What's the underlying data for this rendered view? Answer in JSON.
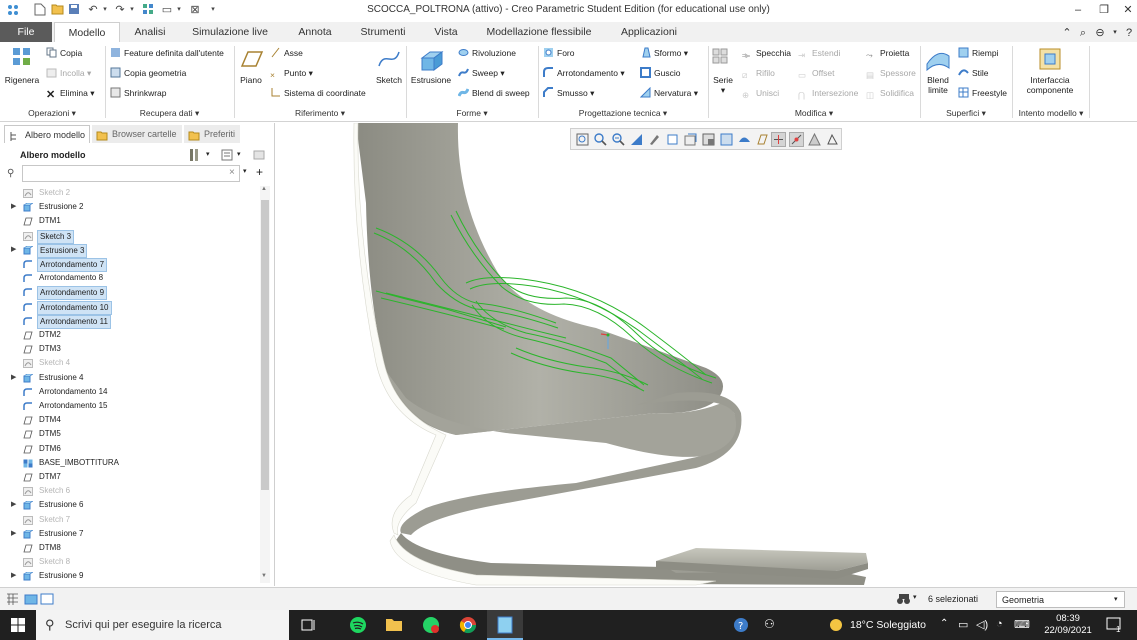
{
  "window": {
    "title": "SCOCCA_POLTRONA (attivo) - Creo Parametric Student Edition (for educational use only)"
  },
  "tabs": [
    "File",
    "Modello",
    "Analisi",
    "Simulazione live",
    "Annota",
    "Strumenti",
    "Vista",
    "Modellazione flessibile",
    "Applicazioni"
  ],
  "ribbon": {
    "operazioni": {
      "rigenera": "Rigenera",
      "copia": "Copia",
      "incolla": "Incolla",
      "elimina": "Elimina",
      "group": "Operazioni"
    },
    "recupera": {
      "feature": "Feature definita dall'utente",
      "copia_geom": "Copia geometria",
      "shrinkwrap": "Shrinkwrap",
      "group": "Recupera dati"
    },
    "riferimento": {
      "piano": "Piano",
      "asse": "Asse",
      "punto": "Punto",
      "sistema": "Sistema di coordinate",
      "sketch": "Sketch",
      "group": "Riferimento"
    },
    "forme": {
      "estrusione": "Estrusione",
      "rivoluzione": "Rivoluzione",
      "sweep": "Sweep",
      "blend": "Blend di sweep",
      "group": "Forme"
    },
    "progettazione": {
      "foro": "Foro",
      "arrotondamento": "Arrotondamento",
      "smusso": "Smusso",
      "sformo": "Sformo",
      "guscio": "Guscio",
      "nervatura": "Nervatura",
      "group": "Progettazione tecnica"
    },
    "modifica": {
      "serie": "Serie",
      "specchia": "Specchia",
      "riempi_rifilo": "Rifilo",
      "unisci": "Unisci",
      "estendi": "Estendi",
      "offset": "Offset",
      "intersezione": "Intersezione",
      "proietta": "Proietta",
      "spessore": "Spessore",
      "solidifica": "Solidifica",
      "group": "Modifica"
    },
    "superfici": {
      "blend_limite": "Blend limite",
      "riempi": "Riempi",
      "stile": "Stile",
      "freestyle": "Freestyle",
      "group": "Superfici"
    },
    "intento": {
      "interfaccia": "Interfaccia componente",
      "group": "Intento modello"
    }
  },
  "panel": {
    "tabs": [
      "Albero modello",
      "Browser cartelle",
      "Preferiti"
    ],
    "header": "Albero modello",
    "tree": [
      {
        "label": "Sketch 2",
        "state": "grey",
        "arrow": false,
        "icon": "sketch"
      },
      {
        "label": "Estrusione 2",
        "state": "normal",
        "arrow": true,
        "icon": "extrude"
      },
      {
        "label": "DTM1",
        "state": "normal",
        "arrow": false,
        "icon": "datum"
      },
      {
        "label": "Sketch 3",
        "state": "sel",
        "arrow": false,
        "icon": "sketch"
      },
      {
        "label": "Estrusione 3",
        "state": "sel",
        "arrow": true,
        "icon": "extrude"
      },
      {
        "label": "Arrotondamento 7",
        "state": "sel",
        "arrow": false,
        "icon": "round"
      },
      {
        "label": "Arrotondamento 8",
        "state": "normal",
        "arrow": false,
        "icon": "round"
      },
      {
        "label": "Arrotondamento 9",
        "state": "sel",
        "arrow": false,
        "icon": "round"
      },
      {
        "label": "Arrotondamento 10",
        "state": "sel",
        "arrow": false,
        "icon": "round"
      },
      {
        "label": "Arrotondamento 11",
        "state": "sel",
        "arrow": false,
        "icon": "round"
      },
      {
        "label": "DTM2",
        "state": "normal",
        "arrow": false,
        "icon": "datum"
      },
      {
        "label": "DTM3",
        "state": "normal",
        "arrow": false,
        "icon": "datum"
      },
      {
        "label": "Sketch 4",
        "state": "grey",
        "arrow": false,
        "icon": "sketch"
      },
      {
        "label": "Estrusione 4",
        "state": "normal",
        "arrow": true,
        "icon": "extrude"
      },
      {
        "label": "Arrotondamento 14",
        "state": "normal",
        "arrow": false,
        "icon": "round"
      },
      {
        "label": "Arrotondamento 15",
        "state": "normal",
        "arrow": false,
        "icon": "round"
      },
      {
        "label": "DTM4",
        "state": "normal",
        "arrow": false,
        "icon": "datum"
      },
      {
        "label": "DTM5",
        "state": "normal",
        "arrow": false,
        "icon": "datum"
      },
      {
        "label": "DTM6",
        "state": "normal",
        "arrow": false,
        "icon": "datum"
      },
      {
        "label": "BASE_IMBOTTITURA",
        "state": "normal",
        "arrow": false,
        "icon": "component"
      },
      {
        "label": "DTM7",
        "state": "normal",
        "arrow": false,
        "icon": "datum"
      },
      {
        "label": "Sketch 6",
        "state": "grey",
        "arrow": false,
        "icon": "sketch"
      },
      {
        "label": "Estrusione 6",
        "state": "normal",
        "arrow": true,
        "icon": "extrude"
      },
      {
        "label": "Sketch 7",
        "state": "grey",
        "arrow": false,
        "icon": "sketch"
      },
      {
        "label": "Estrusione 7",
        "state": "normal",
        "arrow": true,
        "icon": "extrude"
      },
      {
        "label": "DTM8",
        "state": "normal",
        "arrow": false,
        "icon": "datum"
      },
      {
        "label": "Sketch 8",
        "state": "grey",
        "arrow": false,
        "icon": "sketch"
      },
      {
        "label": "Estrusione 9",
        "state": "normal",
        "arrow": true,
        "icon": "extrude"
      }
    ]
  },
  "status": {
    "selection": "6 selezionati",
    "filter": "Geometria"
  },
  "taskbar": {
    "search_placeholder": "Scrivi qui per eseguire la ricerca",
    "weather": "18°C  Soleggiato",
    "time": "08:39",
    "date": "22/09/2021",
    "notif_count": "1"
  },
  "colors": {
    "selection_green": "#2bb52b",
    "model_grey": "#a9a99f",
    "tree_selection": "#cfe3f5"
  }
}
